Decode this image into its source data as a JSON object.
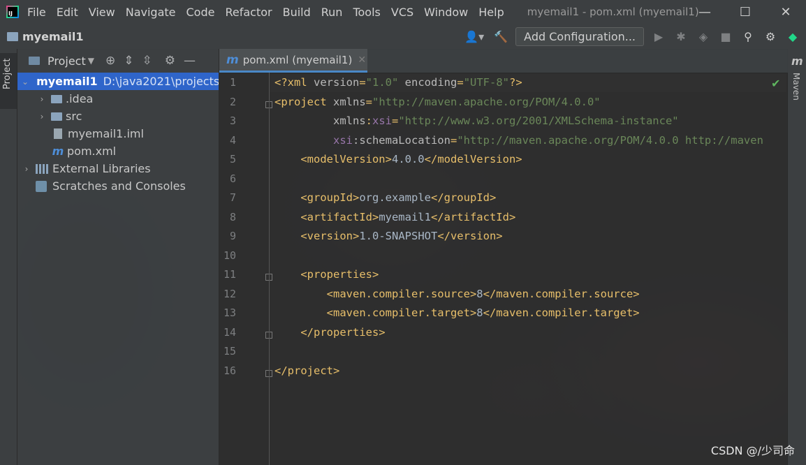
{
  "window": {
    "title": "myemail1 - pom.xml (myemail1)",
    "menu": [
      "File",
      "Edit",
      "View",
      "Navigate",
      "Code",
      "Refactor",
      "Build",
      "Run",
      "Tools",
      "VCS",
      "Window",
      "Help"
    ],
    "controls": [
      "minimize",
      "maximize",
      "close"
    ]
  },
  "navbar": {
    "project_name": "myemail1",
    "add_configuration": "Add Configuration..."
  },
  "sidebar_left": {
    "tab_label": "Project"
  },
  "sidebar_right": {
    "tab_label": "Maven"
  },
  "project_panel": {
    "title": "Project",
    "tree": [
      {
        "label": "myemail1",
        "path": "D:\\java2021\\projects\\",
        "type": "module",
        "expanded": true,
        "selected": true,
        "indent": 0
      },
      {
        "label": ".idea",
        "type": "folder",
        "expanded": false,
        "indent": 1
      },
      {
        "label": "src",
        "type": "folder",
        "expanded": false,
        "indent": 1
      },
      {
        "label": "myemail1.iml",
        "type": "iml",
        "indent": 1
      },
      {
        "label": "pom.xml",
        "type": "maven",
        "indent": 1
      },
      {
        "label": "External Libraries",
        "type": "libraries",
        "expanded": false,
        "indent": 0
      },
      {
        "label": "Scratches and Consoles",
        "type": "scratches",
        "indent": 0
      }
    ]
  },
  "editor": {
    "tab_label": "pom.xml (myemail1)",
    "line_numbers": [
      "1",
      "2",
      "3",
      "4",
      "5",
      "6",
      "7",
      "8",
      "9",
      "10",
      "11",
      "12",
      "13",
      "14",
      "15",
      "16"
    ],
    "lines": [
      [
        [
          "tag",
          "<?xml "
        ],
        [
          "attr",
          "version"
        ],
        [
          "tag",
          "="
        ],
        [
          "val",
          "\"1.0\""
        ],
        [
          "attr",
          " encoding"
        ],
        [
          "tag",
          "="
        ],
        [
          "val",
          "\"UTF-8\""
        ],
        [
          "tag",
          "?>"
        ]
      ],
      [
        [
          "tag",
          "<project "
        ],
        [
          "attr",
          "xmlns"
        ],
        [
          "tag",
          "="
        ],
        [
          "val",
          "\"http://maven.apache.org/POM/4.0.0\""
        ]
      ],
      [
        [
          "attr",
          "         xmlns"
        ],
        [
          "tag",
          ":"
        ],
        [
          "ns",
          "xsi"
        ],
        [
          "tag",
          "="
        ],
        [
          "val",
          "\"http://www.w3.org/2001/XMLSchema-instance\""
        ]
      ],
      [
        [
          "ns",
          "         xsi"
        ],
        [
          "attr",
          ":schemaLocation"
        ],
        [
          "tag",
          "="
        ],
        [
          "val",
          "\"http://maven.apache.org/POM/4.0.0 http://maven"
        ]
      ],
      [
        [
          "tag",
          "    <modelVersion>"
        ],
        [
          "text",
          "4.0.0"
        ],
        [
          "tag",
          "</modelVersion>"
        ]
      ],
      [],
      [
        [
          "tag",
          "    <groupId>"
        ],
        [
          "text",
          "org.example"
        ],
        [
          "tag",
          "</groupId>"
        ]
      ],
      [
        [
          "tag",
          "    <artifactId>"
        ],
        [
          "text",
          "myemail1"
        ],
        [
          "tag",
          "</artifactId>"
        ]
      ],
      [
        [
          "tag",
          "    <version>"
        ],
        [
          "text",
          "1.0-SNAPSHOT"
        ],
        [
          "tag",
          "</version>"
        ]
      ],
      [],
      [
        [
          "tag",
          "    <properties>"
        ]
      ],
      [
        [
          "tag",
          "        <maven.compiler.source>"
        ],
        [
          "text",
          "8"
        ],
        [
          "tag",
          "</maven.compiler.source>"
        ]
      ],
      [
        [
          "tag",
          "        <maven.compiler.target>"
        ],
        [
          "text",
          "8"
        ],
        [
          "tag",
          "</maven.compiler.target>"
        ]
      ],
      [
        [
          "tag",
          "    </properties>"
        ]
      ],
      [],
      [
        [
          "tag",
          "</project>"
        ]
      ]
    ]
  },
  "watermark": "CSDN @/少司命"
}
